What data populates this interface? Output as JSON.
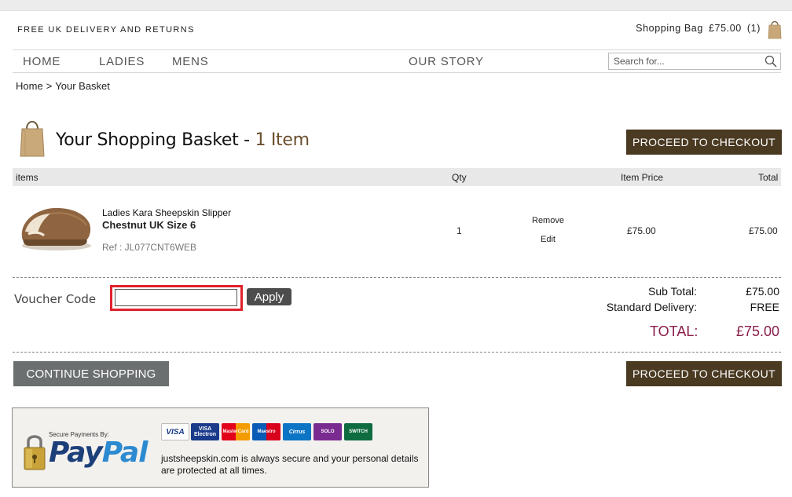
{
  "header": {
    "free_delivery": "FREE UK DELIVERY AND RETURNS",
    "bag_label": "Shopping Bag",
    "bag_amount": "£75.00",
    "bag_count": "(1)"
  },
  "nav": {
    "items": [
      "HOME",
      "LADIES",
      "MENS",
      "OUR STORY"
    ],
    "search_placeholder": "Search for..."
  },
  "breadcrumb": {
    "home": "Home",
    "separator": ">",
    "current": "Your Basket"
  },
  "basket": {
    "title": "Your Shopping Basket -",
    "count_text": "1 Item",
    "checkout_label": "PROCEED TO CHECKOUT"
  },
  "table": {
    "headers": {
      "items": "items",
      "qty": "Qty",
      "price": "Item Price",
      "total": "Total"
    },
    "rows": [
      {
        "name": "Ladies Kara Sheepskin Slipper",
        "variant": "Chestnut UK Size 6",
        "ref": "Ref : JL077CNT6WEB",
        "qty": "1",
        "remove": "Remove",
        "edit": "Edit",
        "price": "£75.00",
        "total": "£75.00"
      }
    ]
  },
  "voucher": {
    "label": "Voucher Code",
    "value": "",
    "apply": "Apply"
  },
  "summary": {
    "subtotal_label": "Sub Total:",
    "subtotal_value": "£75.00",
    "delivery_label": "Standard Delivery:",
    "delivery_value": "FREE",
    "total_label": "TOTAL:",
    "total_value": "£75.00"
  },
  "footer": {
    "continue_label": "CONTINUE SHOPPING",
    "secure_by": "Secure Payments By:",
    "paypal_a": "Pay",
    "paypal_b": "Pal",
    "secure_text": "justsheepskin.com is always secure and your personal details are protected at all times.",
    "cards": [
      "VISA",
      "VISA Electron",
      "MasterCard",
      "Maestro",
      "Cirrus",
      "SOLO",
      "SWITCH"
    ]
  },
  "colors": {
    "dark_button": "#4a3a22",
    "grey_button": "#6c6f70",
    "total_accent": "#8a1e4b",
    "count_accent": "#6b4f2e",
    "highlight_outline": "#e0222c"
  }
}
